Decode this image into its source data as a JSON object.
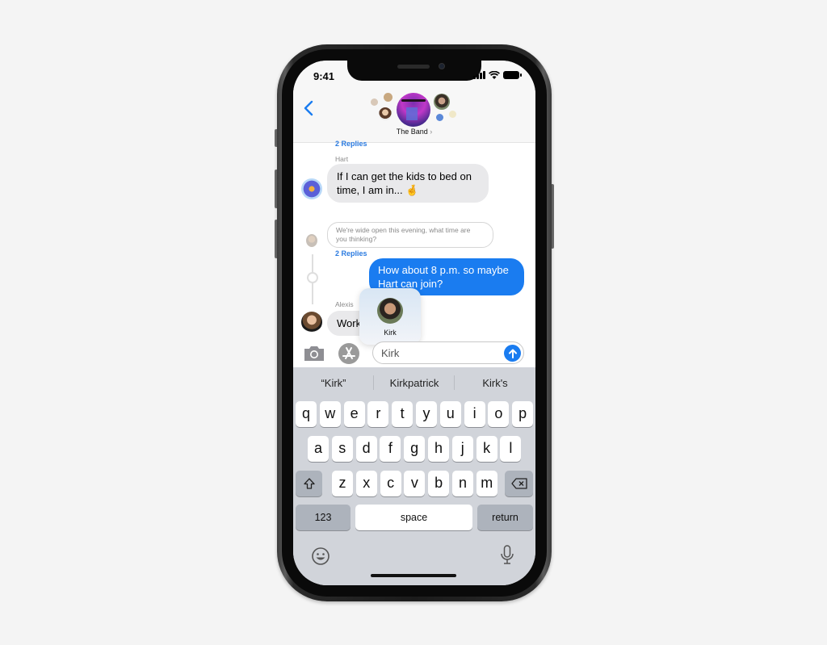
{
  "status_bar": {
    "time": "9:41"
  },
  "header": {
    "back_icon": "chevron-left-icon",
    "group_name": "The Band",
    "group_chevron": "›"
  },
  "messages": {
    "replies_top": "2 Replies",
    "hart": {
      "sender": "Hart",
      "text_line1": "If I can get the kids to bed on",
      "text_line2": "time, I am in... 🤞"
    },
    "quoted": {
      "text_line1": "We're wide open this evening, what time are",
      "text_line2": "you thinking?"
    },
    "replies_mid": "2 Replies",
    "outgoing": {
      "text_line1": "How about 8 p.m. so maybe",
      "text_line2": "Hart can join?"
    },
    "alexis": {
      "sender": "Alexis",
      "text": "Work"
    }
  },
  "mention_popup": {
    "name": "Kirk"
  },
  "compose": {
    "camera_icon": "camera-icon",
    "apps_icon": "app-store-icon",
    "input_value": "Kirk",
    "send_icon": "arrow-up-icon"
  },
  "keyboard": {
    "suggestions": [
      "“Kirk”",
      "Kirkpatrick",
      "Kirk's"
    ],
    "row1": [
      "q",
      "w",
      "e",
      "r",
      "t",
      "y",
      "u",
      "i",
      "o",
      "p"
    ],
    "row2": [
      "a",
      "s",
      "d",
      "f",
      "g",
      "h",
      "j",
      "k",
      "l"
    ],
    "row3": [
      "z",
      "x",
      "c",
      "v",
      "b",
      "n",
      "m"
    ],
    "numbers_label": "123",
    "space_label": "space",
    "return_label": "return"
  },
  "colors": {
    "accent": "#1a7cf0",
    "incoming_bubble": "#e9e9eb",
    "keyboard_bg": "#d1d4da"
  }
}
